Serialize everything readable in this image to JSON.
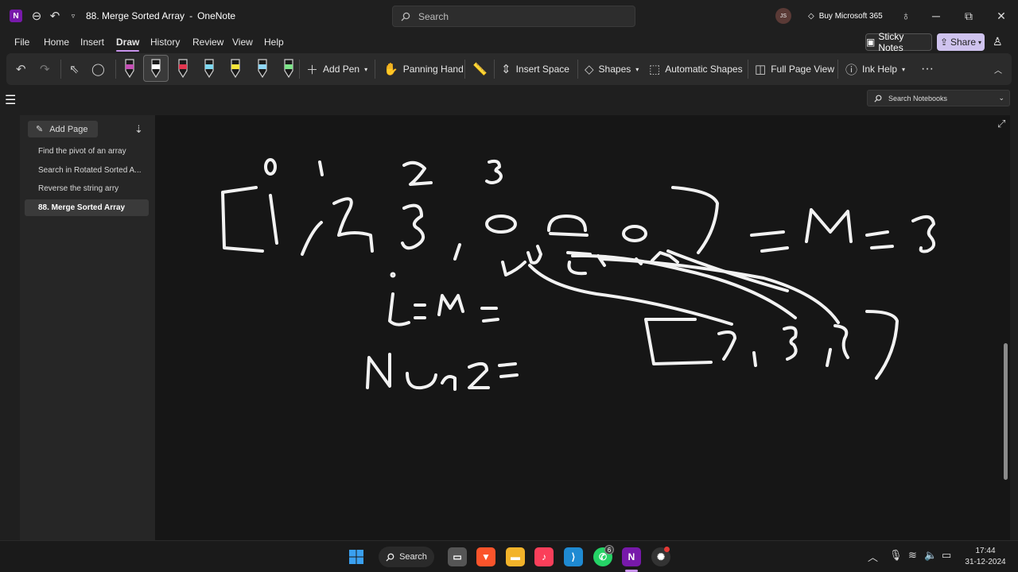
{
  "titlebar": {
    "logo": "N",
    "doc_title": "88. Merge Sorted Array",
    "app_sep": "-",
    "app_name": "OneNote",
    "search_placeholder": "Search",
    "avatar_initials": "JS",
    "buy_label": "Buy Microsoft 365"
  },
  "menu": [
    "File",
    "Home",
    "Insert",
    "Draw",
    "History",
    "Review",
    "View",
    "Help"
  ],
  "menu_active": "Draw",
  "sticky_label": "Sticky Notes",
  "share_label": "Share",
  "ribbon": {
    "add_pen": "Add Pen",
    "panning_hand": "Panning Hand",
    "insert_space": "Insert Space",
    "shapes": "Shapes",
    "automatic_shapes": "Automatic Shapes",
    "full_page_view": "Full Page View",
    "ink_help": "Ink Help",
    "more": "···"
  },
  "pen_colors": [
    "#c54fb5",
    "#ffffff",
    "#e2364f",
    "#7fd8f0",
    "#f6e53b",
    "#8fd6f5",
    "#7ee48a"
  ],
  "search_notebooks": "Search Notebooks",
  "pages_pane": {
    "add_page": "Add Page",
    "items": [
      {
        "label": "Find the pivot of an array",
        "active": false
      },
      {
        "label": "Search in Rotated Sorted A...",
        "active": false
      },
      {
        "label": "Reverse the string arry",
        "active": false
      },
      {
        "label": "88. Merge Sorted Array",
        "active": true
      }
    ]
  },
  "taskbar": {
    "search_label": "Search",
    "whatsapp_badge": "6",
    "time": "17:44",
    "date": "31-12-2024"
  }
}
